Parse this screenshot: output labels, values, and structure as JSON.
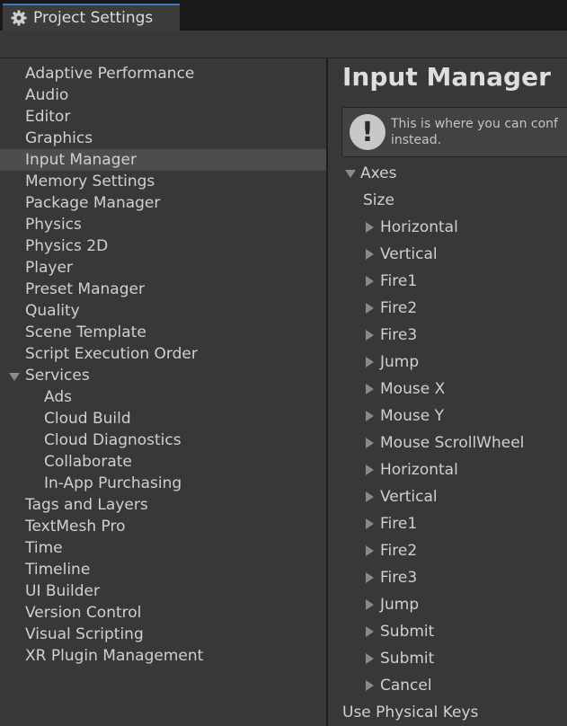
{
  "window": {
    "tab_title": "Project Settings",
    "tab_icon": "gear-icon"
  },
  "sidebar": {
    "selected": "Input Manager",
    "items": [
      {
        "label": "Adaptive Performance"
      },
      {
        "label": "Audio"
      },
      {
        "label": "Editor"
      },
      {
        "label": "Graphics"
      },
      {
        "label": "Input Manager",
        "selected": true
      },
      {
        "label": "Memory Settings"
      },
      {
        "label": "Package Manager"
      },
      {
        "label": "Physics"
      },
      {
        "label": "Physics 2D"
      },
      {
        "label": "Player"
      },
      {
        "label": "Preset Manager"
      },
      {
        "label": "Quality"
      },
      {
        "label": "Scene Template"
      },
      {
        "label": "Script Execution Order"
      },
      {
        "label": "Services",
        "expanded": true
      },
      {
        "label": "Ads",
        "child": true
      },
      {
        "label": "Cloud Build",
        "child": true
      },
      {
        "label": "Cloud Diagnostics",
        "child": true
      },
      {
        "label": "Collaborate",
        "child": true
      },
      {
        "label": "In-App Purchasing",
        "child": true
      },
      {
        "label": "Tags and Layers"
      },
      {
        "label": "TextMesh Pro"
      },
      {
        "label": "Time"
      },
      {
        "label": "Timeline"
      },
      {
        "label": "UI Builder"
      },
      {
        "label": "Version Control"
      },
      {
        "label": "Visual Scripting"
      },
      {
        "label": "XR Plugin Management"
      }
    ]
  },
  "main": {
    "title": "Input Manager",
    "help": {
      "icon": "exclamation-icon",
      "text": "This is where you can conf\ninstead."
    },
    "axes": {
      "label": "Axes",
      "expanded": true,
      "size_label": "Size",
      "items": [
        "Horizontal",
        "Vertical",
        "Fire1",
        "Fire2",
        "Fire3",
        "Jump",
        "Mouse X",
        "Mouse Y",
        "Mouse ScrollWheel",
        "Horizontal",
        "Vertical",
        "Fire1",
        "Fire2",
        "Fire3",
        "Jump",
        "Submit",
        "Submit",
        "Cancel"
      ]
    },
    "use_physical_keys_label": "Use Physical Keys"
  },
  "colors": {
    "background": "#383838",
    "selection": "#4d4d4d",
    "tab_accent": "#3a79bb",
    "text": "#d0d0d0"
  }
}
